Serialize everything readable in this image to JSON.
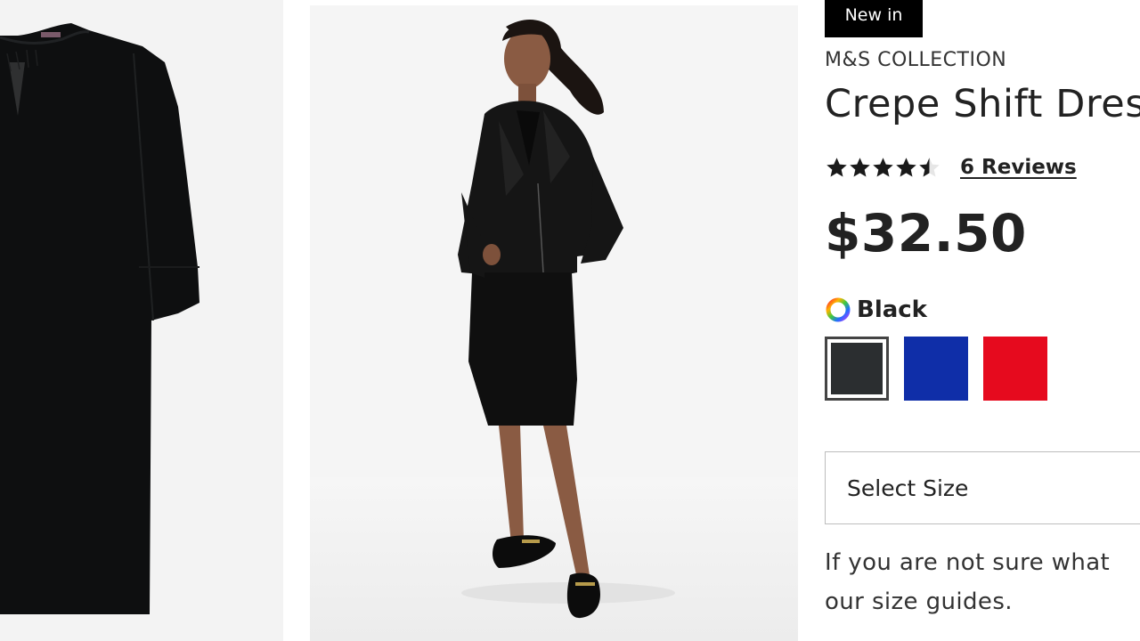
{
  "images": [
    {
      "name": "dress-flat-image"
    },
    {
      "name": "model-image"
    }
  ],
  "product": {
    "badge": "New in",
    "brand": "M&S COLLECTION",
    "title": "Crepe Shift Dress",
    "rating": {
      "value": 4.5,
      "max": 5
    },
    "reviews_label": "6 Reviews",
    "price": "$32.50",
    "colour": {
      "selected_label": "Black",
      "swatches": [
        {
          "name": "Black",
          "hex": "#2b2e30",
          "selected": true
        },
        {
          "name": "Blue",
          "hex": "#0f2ea8",
          "selected": false
        },
        {
          "name": "Red",
          "hex": "#e60a1e",
          "selected": false
        }
      ]
    },
    "size": {
      "select_label": "Select Size",
      "help_line1": "If you are not sure what",
      "help_line2": "our size guides."
    }
  },
  "colors": {
    "badge_bg": "#000000",
    "text": "#222222",
    "border": "#bdbdbd"
  }
}
